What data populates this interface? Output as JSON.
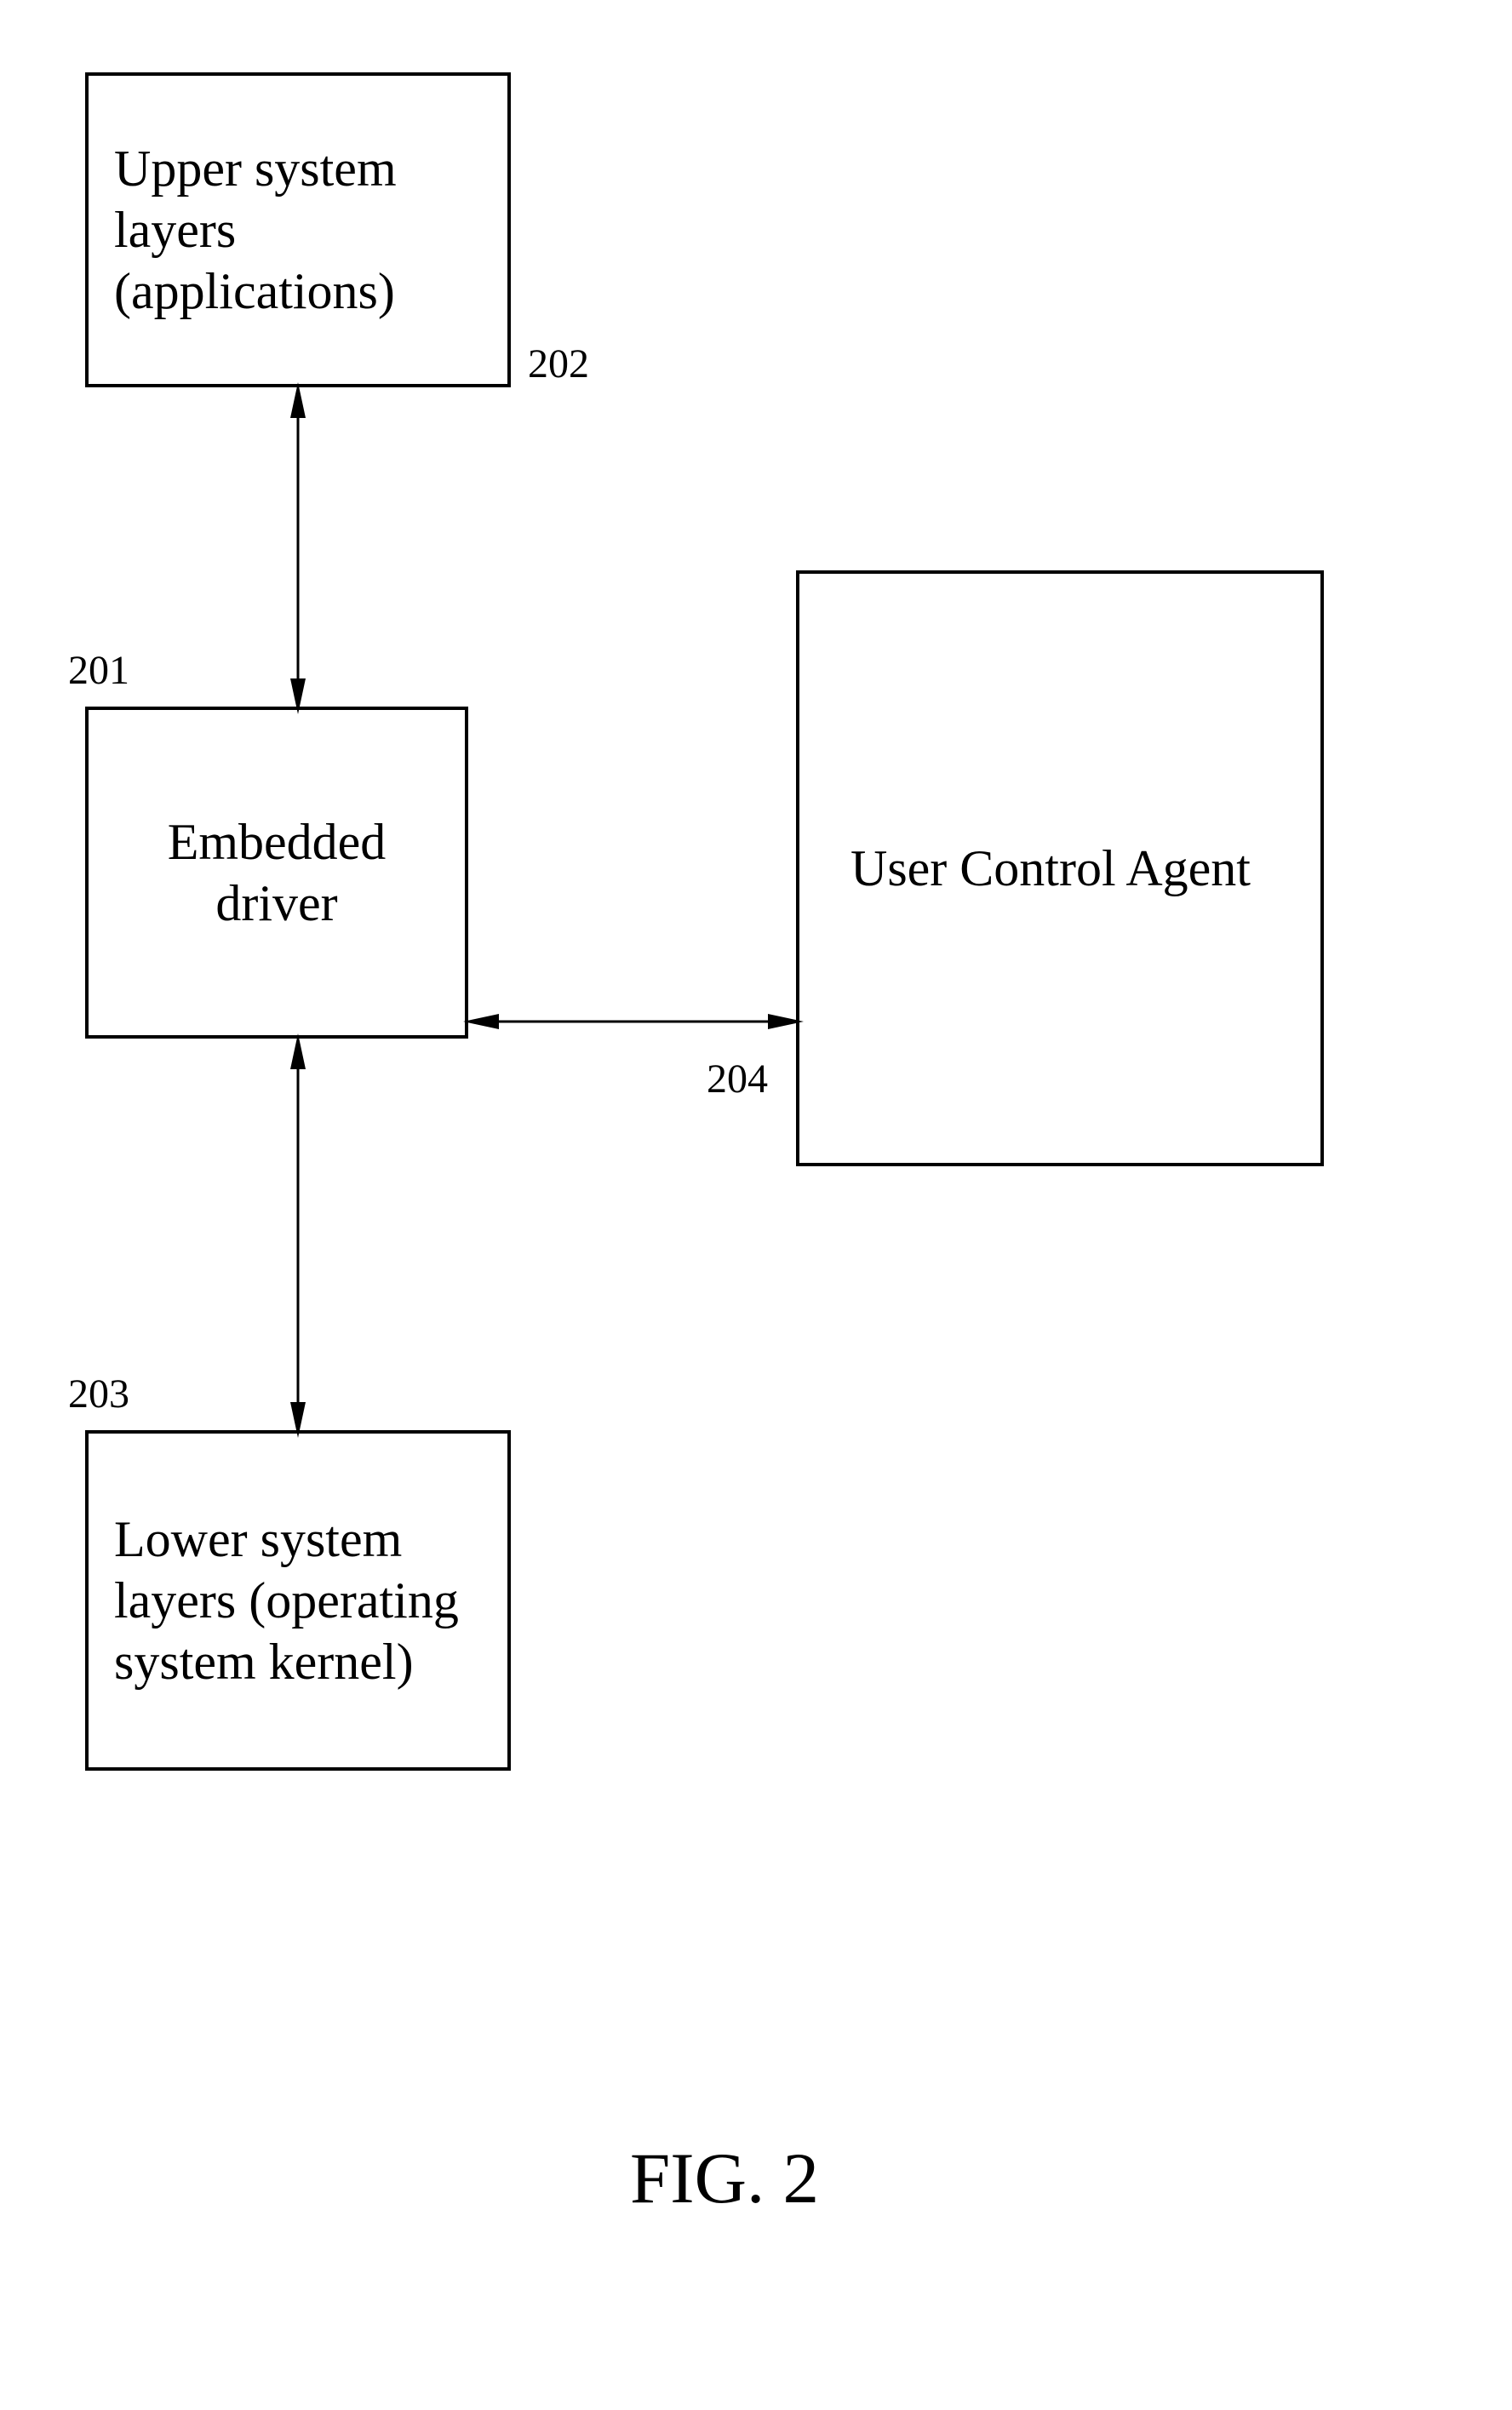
{
  "boxes": {
    "upper": {
      "text": "Upper system layers (applications)",
      "ref": "202"
    },
    "embedded": {
      "text": "Embedded driver",
      "ref": "201"
    },
    "lower": {
      "text": "Lower system layers (operating system kernel)",
      "ref": "203"
    },
    "agent": {
      "text": "User Control Agent",
      "ref": "204"
    }
  },
  "figure_caption": "FIG. 2"
}
